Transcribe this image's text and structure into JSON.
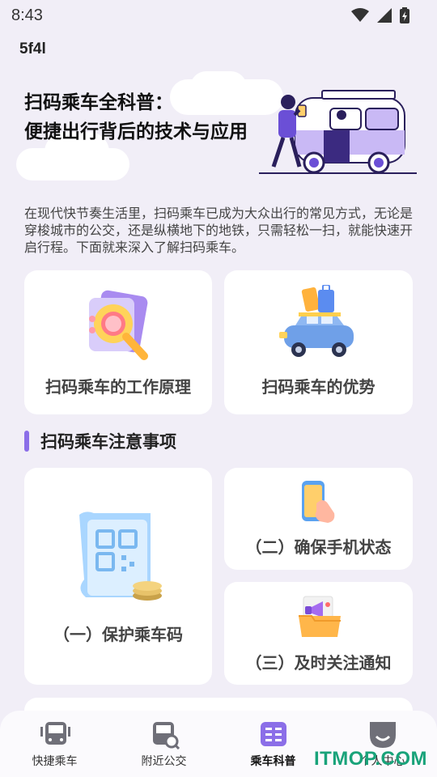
{
  "status": {
    "time": "8:43"
  },
  "app": {
    "title": "5f4l"
  },
  "hero": {
    "title_line1": "扫码乘车全科普：",
    "title_line2": "便捷出行背后的技术与应用"
  },
  "intro": "在现代快节奏生活里，扫码乘车已成为大众出行的常见方式，无论是穿梭城市的公交，还是纵横地下的地铁，只需轻松一扫，就能快速开启行程。下面就来深入了解扫码乘车。",
  "top_cards": [
    {
      "label": "扫码乘车的工作原理",
      "icon": "magnifier-icon"
    },
    {
      "label": "扫码乘车的优势",
      "icon": "car-luggage-icon"
    }
  ],
  "section": {
    "title": "扫码乘车注意事项"
  },
  "notice_cards": [
    {
      "label": "（一）保护乘车码",
      "icon": "qr-code-coins-icon"
    },
    {
      "label": "（二）确保手机状态",
      "icon": "phone-hand-icon"
    },
    {
      "label": "（三）及时关注通知",
      "icon": "megaphone-folder-icon"
    }
  ],
  "nav": {
    "items": [
      {
        "label": "快捷乘车",
        "icon": "bus-icon"
      },
      {
        "label": "附近公交",
        "icon": "bus-search-icon"
      },
      {
        "label": "乘车科普",
        "icon": "book-icon",
        "active": true
      },
      {
        "label": "个人中心",
        "icon": "profile-icon"
      }
    ]
  },
  "watermark": "ITMOP.COM",
  "colors": {
    "accent": "#8b6ee8",
    "background": "#f1eef7",
    "watermark": "#19a37a"
  }
}
